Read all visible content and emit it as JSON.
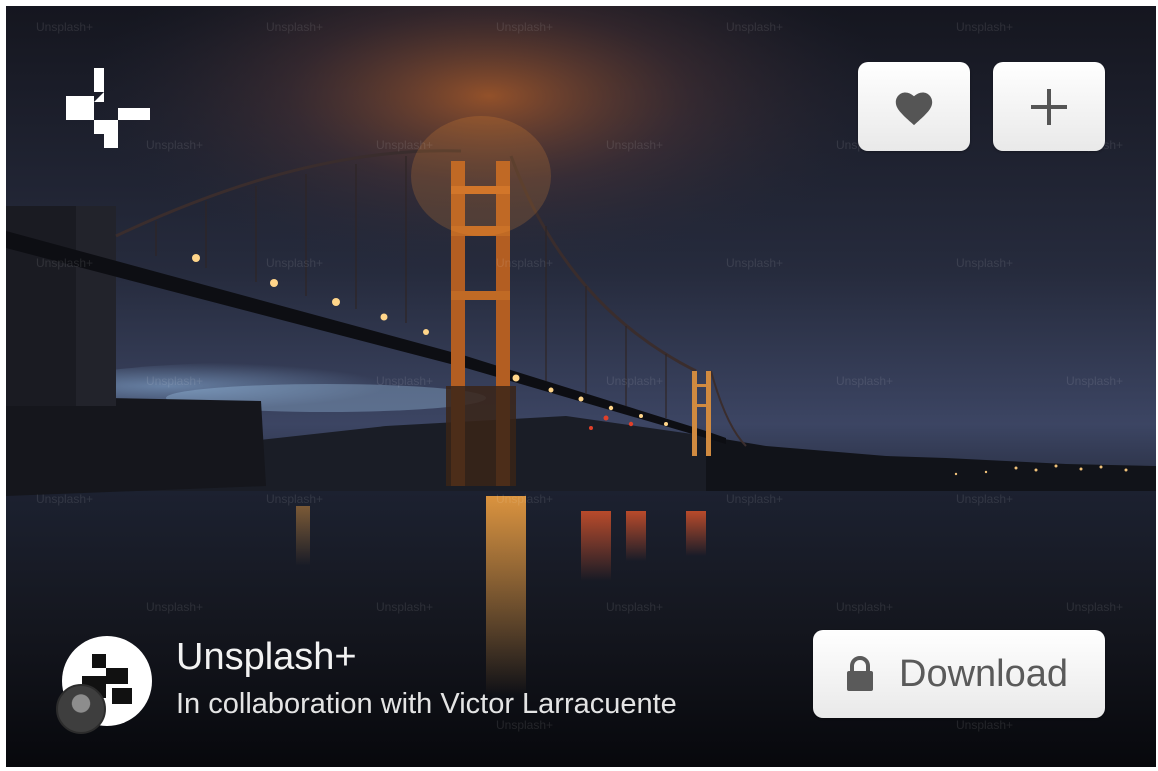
{
  "watermark_text": "Unsplash+",
  "buttons": {
    "like_icon": "heart-icon",
    "add_icon": "plus-icon",
    "download_label": "Download",
    "download_icon": "lock-icon"
  },
  "author": {
    "name": "Unsplash+",
    "collaboration": "In collaboration with Victor Larracuente"
  },
  "colors": {
    "button_bg": "#f4f4f4",
    "icon": "#555555",
    "sky": "#2a3045",
    "bridge_light": "#f0a040"
  }
}
